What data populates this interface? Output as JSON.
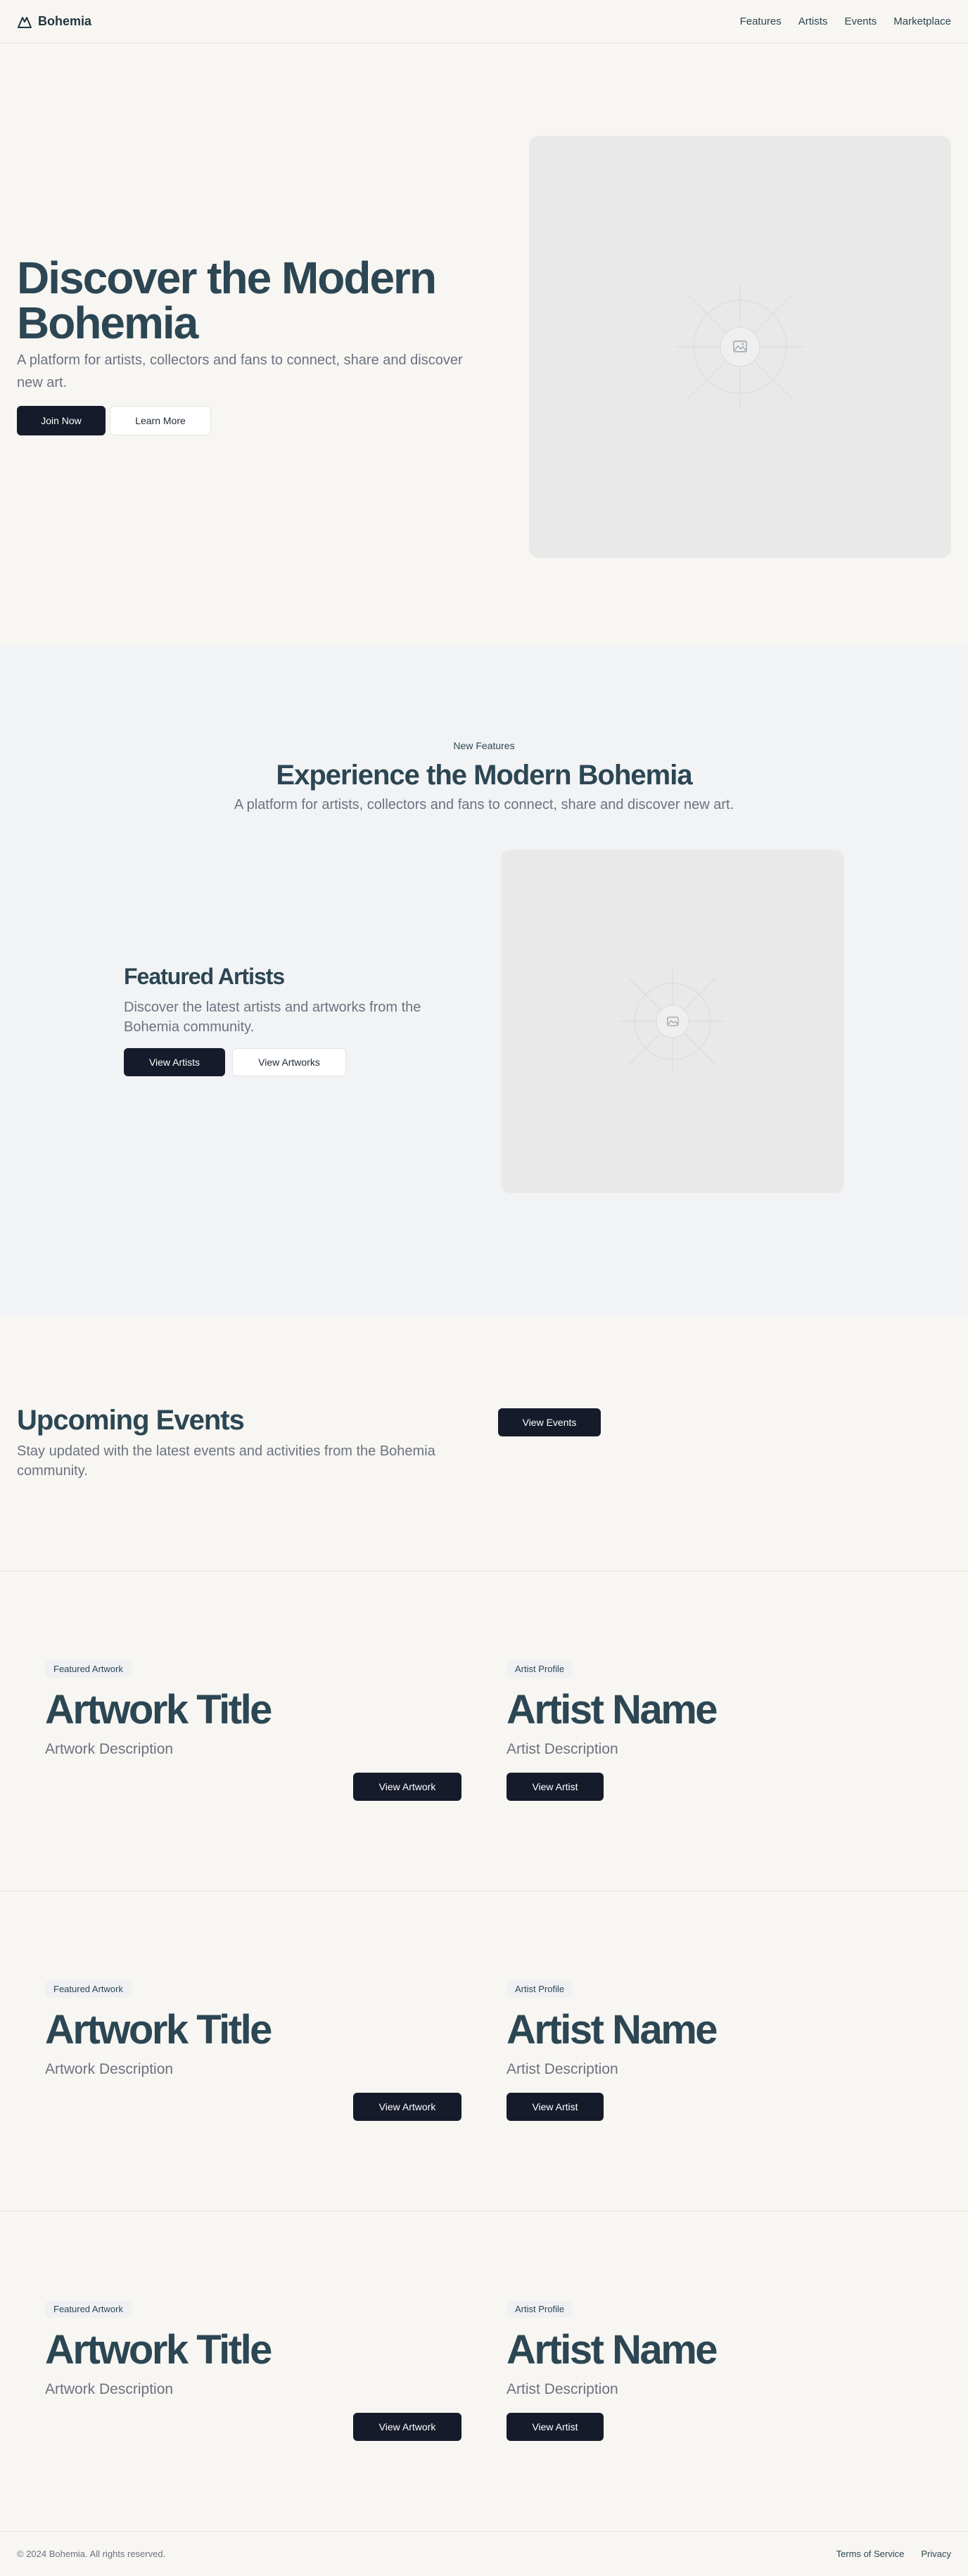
{
  "header": {
    "brand": "Bohemia",
    "nav": [
      "Features",
      "Artists",
      "Events",
      "Marketplace"
    ]
  },
  "hero": {
    "title": "Discover the Modern Bohemia",
    "subtitle": "A platform for artists, collectors and fans to connect, share and discover new art.",
    "primary_cta": "Join Now",
    "secondary_cta": "Learn More"
  },
  "features": {
    "eyebrow": "New Features",
    "title": "Experience the Modern Bohemia",
    "subtitle": "A platform for artists, collectors and fans to connect, share and discover new art.",
    "featured_title": "Featured Artists",
    "featured_subtitle": "Discover the latest artists and artworks from the Bohemia community.",
    "primary_cta": "View Artists",
    "secondary_cta": "View Artworks"
  },
  "events": {
    "title": "Upcoming Events",
    "subtitle": "Stay updated with the latest events and activities from the Bohemia community.",
    "cta": "View Events"
  },
  "rows": [
    {
      "artwork": {
        "badge": "Featured Artwork",
        "title": "Artwork Title",
        "description": "Artwork Description",
        "cta": "View Artwork"
      },
      "artist": {
        "badge": "Artist Profile",
        "title": "Artist Name",
        "description": "Artist Description",
        "cta": "View Artist"
      }
    },
    {
      "artwork": {
        "badge": "Featured Artwork",
        "title": "Artwork Title",
        "description": "Artwork Description",
        "cta": "View Artwork"
      },
      "artist": {
        "badge": "Artist Profile",
        "title": "Artist Name",
        "description": "Artist Description",
        "cta": "View Artist"
      }
    },
    {
      "artwork": {
        "badge": "Featured Artwork",
        "title": "Artwork Title",
        "description": "Artwork Description",
        "cta": "View Artwork"
      },
      "artist": {
        "badge": "Artist Profile",
        "title": "Artist Name",
        "description": "Artist Description",
        "cta": "View Artist"
      }
    }
  ],
  "footer": {
    "copyright": "© 2024 Bohemia. All rights reserved.",
    "links": [
      "Terms of Service",
      "Privacy"
    ]
  },
  "colors": {
    "background": "#f8f6f2",
    "section_alt": "#f2f3f5",
    "heading": "#2c4653",
    "button_dark": "#161b2b",
    "muted": "#6b7280"
  },
  "icons": {
    "brand": "mountain-icon",
    "placeholder": "image-placeholder-icon"
  }
}
